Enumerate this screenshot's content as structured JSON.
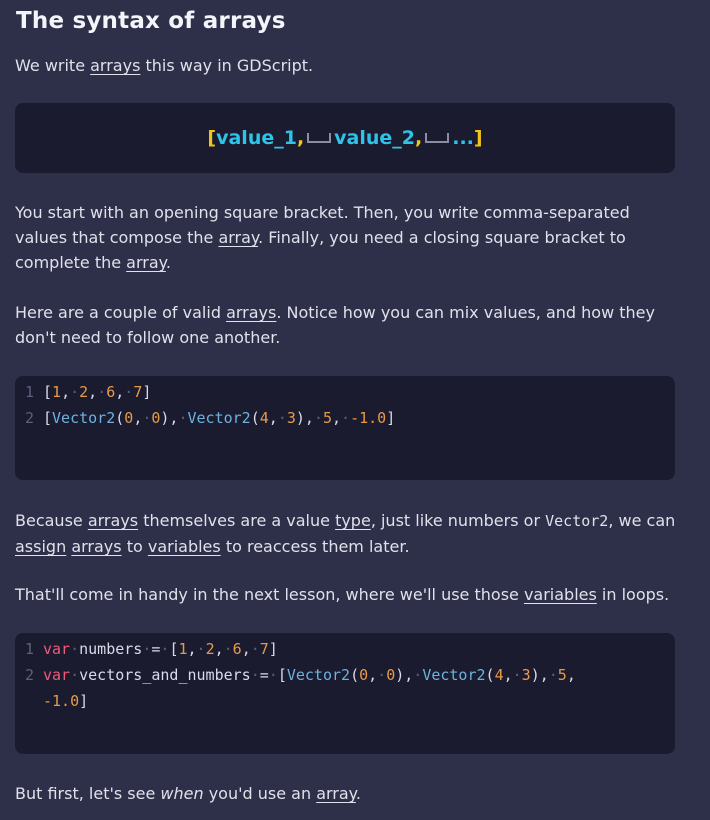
{
  "heading": "The syntax of arrays",
  "intro": {
    "before": "We write ",
    "link": "arrays",
    "after": " this way in GDScript."
  },
  "syntax_box": {
    "open": "[",
    "v1": "value_1",
    "comma1": ",",
    "v2": "value_2",
    "comma2": ",",
    "ellipsis": "...",
    "close": "]"
  },
  "para1": {
    "t1": "You start with an opening square bracket. Then, you write comma-separated values that compose the ",
    "l1": "array",
    "t2": ". Finally, you need a closing square bracket to complete the ",
    "l2": "array",
    "t3": "."
  },
  "para2": {
    "t1": "Here are a couple of valid ",
    "l1": "arrays",
    "t2": ". Notice how you can mix values, and how they don't need to follow one another."
  },
  "code1": {
    "lines": [
      {
        "n": "1",
        "text": "[1, 2, 6, 7]"
      },
      {
        "n": "2",
        "text": "[Vector2(0, 0), Vector2(4, 3), 5, -1.0]"
      }
    ]
  },
  "para3": {
    "t1": "Because ",
    "l1": "arrays",
    "t2": " themselves are a value ",
    "l2": "type",
    "t3": ", just like numbers or ",
    "code": "Vector2",
    "t4": ", we can ",
    "l3": "assign",
    "t5": " ",
    "l4": "arrays",
    "t6": " to ",
    "l5": "variables",
    "t7": " to reaccess them later."
  },
  "para4": {
    "t1": "That'll come in handy in the next lesson, where we'll use those ",
    "l1": "variables",
    "t2": " in loops."
  },
  "code2": {
    "lines": [
      {
        "n": "1",
        "text": "var numbers = [1, 2, 6, 7]"
      },
      {
        "n": "2",
        "text": "var vectors_and_numbers = [Vector2(0, 0), Vector2(4, 3), 5, -1.0]"
      }
    ]
  },
  "para5": {
    "t1": "But first, let's see ",
    "em": "when",
    "t2": " you'd use an ",
    "l1": "array",
    "t3": "."
  },
  "colors": {
    "background": "#2e2f48",
    "code_background": "#1b1b30",
    "keyword": "#ee5a7a",
    "number": "#e79a46",
    "function": "#6cb2df",
    "bracket_yellow": "#f2c418",
    "value_cyan": "#2ec4ea"
  }
}
